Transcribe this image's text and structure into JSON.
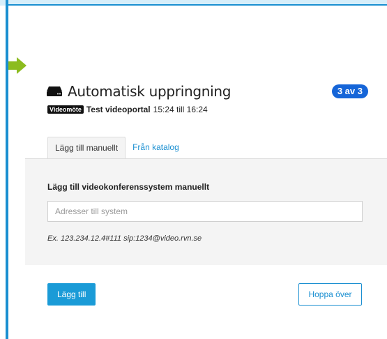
{
  "dialog": {
    "title": "Automatisk uppringning",
    "title_icon": "video-device-icon",
    "step_badge": "3 av 3"
  },
  "meeting": {
    "tag": "Videomöte",
    "name": "Test videoportal",
    "time": "15:24 till 16:24"
  },
  "tabs": [
    {
      "label": "Lägg till manuellt",
      "active": true
    },
    {
      "label": "Från katalog",
      "active": false
    }
  ],
  "manual": {
    "heading": "Lägg till videokonferenssystem manuellt",
    "input_placeholder": "Adresser till system",
    "input_value": "",
    "example": "Ex. 123.234.12.4#111 sip:1234@video.rvn.se"
  },
  "actions": {
    "add_label": "Lägg till",
    "skip_label": "Hoppa över"
  },
  "colors": {
    "accent": "#1a8fd1",
    "badge": "#1565d8",
    "arrow": "#8cbc1f"
  }
}
